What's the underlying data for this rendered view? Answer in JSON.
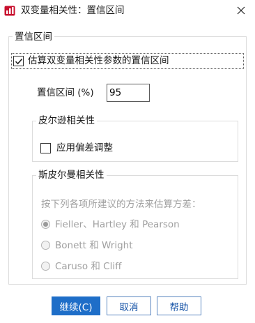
{
  "window": {
    "title": "双变量相关性：置信区间",
    "icon": "spss-chart-icon",
    "close_glyph": "✕"
  },
  "ci_group": {
    "legend": "置信区间",
    "estimate_checkbox": {
      "label": "估算双变量相关性参数的置信区间",
      "checked": true
    },
    "ci_level_label": "置信区间 (%)",
    "ci_level_value": "95",
    "pearson": {
      "legend": "皮尔逊相关性",
      "bias_checkbox": {
        "label": "应用偏差调整",
        "checked": false
      }
    },
    "spearman": {
      "legend": "斯皮尔曼相关性",
      "prompt": "按下列各项所建议的方法来估算方差：",
      "options": [
        {
          "label": "Fieller、Hartley 和 Pearson",
          "selected": true
        },
        {
          "label": "Bonett 和 Wright",
          "selected": false
        },
        {
          "label": "Caruso 和 Cliff",
          "selected": false
        }
      ]
    }
  },
  "buttons": {
    "continue": "继续(C)",
    "cancel": "取消",
    "help": "帮助"
  },
  "colors": {
    "accent": "#1e6ec8",
    "disabled_text": "#a0a0a0",
    "group_border": "#dcdcdc"
  }
}
